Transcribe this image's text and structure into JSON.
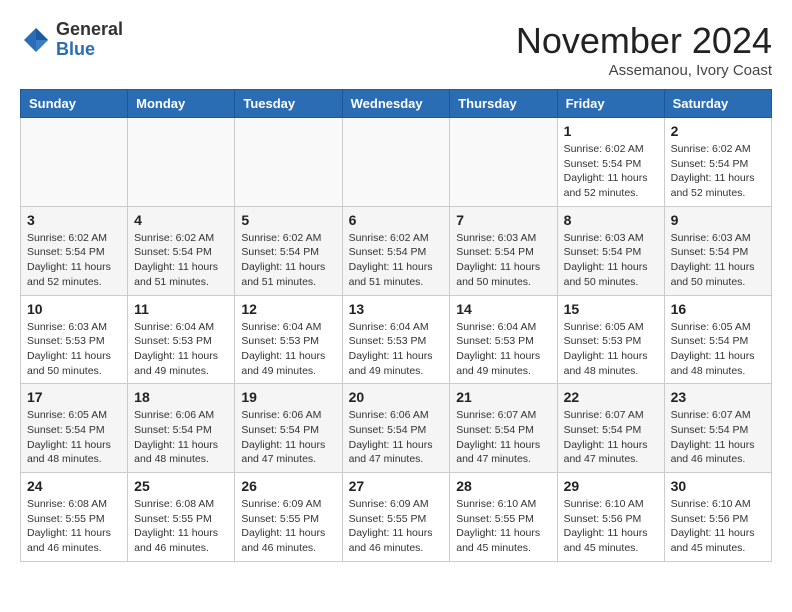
{
  "header": {
    "logo_line1": "General",
    "logo_line2": "Blue",
    "month": "November 2024",
    "location": "Assemanou, Ivory Coast"
  },
  "weekdays": [
    "Sunday",
    "Monday",
    "Tuesday",
    "Wednesday",
    "Thursday",
    "Friday",
    "Saturday"
  ],
  "weeks": [
    [
      {
        "day": "",
        "info": ""
      },
      {
        "day": "",
        "info": ""
      },
      {
        "day": "",
        "info": ""
      },
      {
        "day": "",
        "info": ""
      },
      {
        "day": "",
        "info": ""
      },
      {
        "day": "1",
        "info": "Sunrise: 6:02 AM\nSunset: 5:54 PM\nDaylight: 11 hours\nand 52 minutes."
      },
      {
        "day": "2",
        "info": "Sunrise: 6:02 AM\nSunset: 5:54 PM\nDaylight: 11 hours\nand 52 minutes."
      }
    ],
    [
      {
        "day": "3",
        "info": "Sunrise: 6:02 AM\nSunset: 5:54 PM\nDaylight: 11 hours\nand 52 minutes."
      },
      {
        "day": "4",
        "info": "Sunrise: 6:02 AM\nSunset: 5:54 PM\nDaylight: 11 hours\nand 51 minutes."
      },
      {
        "day": "5",
        "info": "Sunrise: 6:02 AM\nSunset: 5:54 PM\nDaylight: 11 hours\nand 51 minutes."
      },
      {
        "day": "6",
        "info": "Sunrise: 6:02 AM\nSunset: 5:54 PM\nDaylight: 11 hours\nand 51 minutes."
      },
      {
        "day": "7",
        "info": "Sunrise: 6:03 AM\nSunset: 5:54 PM\nDaylight: 11 hours\nand 50 minutes."
      },
      {
        "day": "8",
        "info": "Sunrise: 6:03 AM\nSunset: 5:54 PM\nDaylight: 11 hours\nand 50 minutes."
      },
      {
        "day": "9",
        "info": "Sunrise: 6:03 AM\nSunset: 5:54 PM\nDaylight: 11 hours\nand 50 minutes."
      }
    ],
    [
      {
        "day": "10",
        "info": "Sunrise: 6:03 AM\nSunset: 5:53 PM\nDaylight: 11 hours\nand 50 minutes."
      },
      {
        "day": "11",
        "info": "Sunrise: 6:04 AM\nSunset: 5:53 PM\nDaylight: 11 hours\nand 49 minutes."
      },
      {
        "day": "12",
        "info": "Sunrise: 6:04 AM\nSunset: 5:53 PM\nDaylight: 11 hours\nand 49 minutes."
      },
      {
        "day": "13",
        "info": "Sunrise: 6:04 AM\nSunset: 5:53 PM\nDaylight: 11 hours\nand 49 minutes."
      },
      {
        "day": "14",
        "info": "Sunrise: 6:04 AM\nSunset: 5:53 PM\nDaylight: 11 hours\nand 49 minutes."
      },
      {
        "day": "15",
        "info": "Sunrise: 6:05 AM\nSunset: 5:53 PM\nDaylight: 11 hours\nand 48 minutes."
      },
      {
        "day": "16",
        "info": "Sunrise: 6:05 AM\nSunset: 5:54 PM\nDaylight: 11 hours\nand 48 minutes."
      }
    ],
    [
      {
        "day": "17",
        "info": "Sunrise: 6:05 AM\nSunset: 5:54 PM\nDaylight: 11 hours\nand 48 minutes."
      },
      {
        "day": "18",
        "info": "Sunrise: 6:06 AM\nSunset: 5:54 PM\nDaylight: 11 hours\nand 48 minutes."
      },
      {
        "day": "19",
        "info": "Sunrise: 6:06 AM\nSunset: 5:54 PM\nDaylight: 11 hours\nand 47 minutes."
      },
      {
        "day": "20",
        "info": "Sunrise: 6:06 AM\nSunset: 5:54 PM\nDaylight: 11 hours\nand 47 minutes."
      },
      {
        "day": "21",
        "info": "Sunrise: 6:07 AM\nSunset: 5:54 PM\nDaylight: 11 hours\nand 47 minutes."
      },
      {
        "day": "22",
        "info": "Sunrise: 6:07 AM\nSunset: 5:54 PM\nDaylight: 11 hours\nand 47 minutes."
      },
      {
        "day": "23",
        "info": "Sunrise: 6:07 AM\nSunset: 5:54 PM\nDaylight: 11 hours\nand 46 minutes."
      }
    ],
    [
      {
        "day": "24",
        "info": "Sunrise: 6:08 AM\nSunset: 5:55 PM\nDaylight: 11 hours\nand 46 minutes."
      },
      {
        "day": "25",
        "info": "Sunrise: 6:08 AM\nSunset: 5:55 PM\nDaylight: 11 hours\nand 46 minutes."
      },
      {
        "day": "26",
        "info": "Sunrise: 6:09 AM\nSunset: 5:55 PM\nDaylight: 11 hours\nand 46 minutes."
      },
      {
        "day": "27",
        "info": "Sunrise: 6:09 AM\nSunset: 5:55 PM\nDaylight: 11 hours\nand 46 minutes."
      },
      {
        "day": "28",
        "info": "Sunrise: 6:10 AM\nSunset: 5:55 PM\nDaylight: 11 hours\nand 45 minutes."
      },
      {
        "day": "29",
        "info": "Sunrise: 6:10 AM\nSunset: 5:56 PM\nDaylight: 11 hours\nand 45 minutes."
      },
      {
        "day": "30",
        "info": "Sunrise: 6:10 AM\nSunset: 5:56 PM\nDaylight: 11 hours\nand 45 minutes."
      }
    ]
  ]
}
